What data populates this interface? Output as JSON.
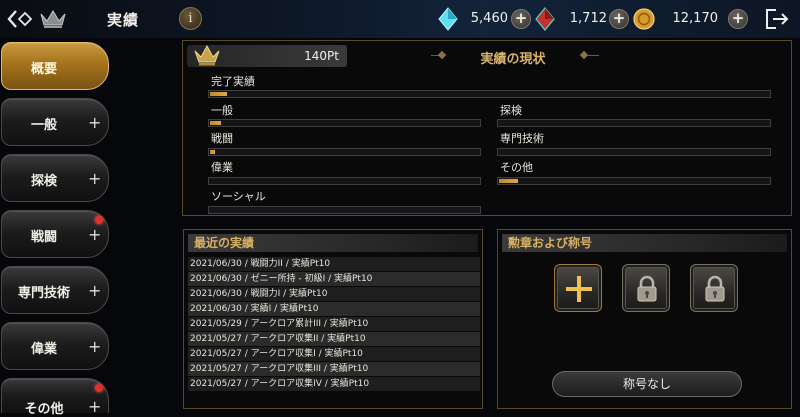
{
  "header": {
    "title": "実績",
    "info_label": "i",
    "currencies": [
      {
        "name": "blue-crystal",
        "value": "5,460",
        "color": "#46d0e6"
      },
      {
        "name": "red-crystal",
        "value": "1,712",
        "color": "#d13a3a"
      },
      {
        "name": "gold-coin",
        "value": "12,170",
        "color": "#d79a2a"
      }
    ],
    "plus_label": "+"
  },
  "sidebar": {
    "items": [
      {
        "label": "概要",
        "active": true,
        "plus": ""
      },
      {
        "label": "一般",
        "active": false,
        "plus": "+"
      },
      {
        "label": "探検",
        "active": false,
        "plus": "+"
      },
      {
        "label": "戦闘",
        "active": false,
        "plus": "+",
        "notify": true
      },
      {
        "label": "専門技術",
        "active": false,
        "plus": "+"
      },
      {
        "label": "偉業",
        "active": false,
        "plus": "+"
      },
      {
        "label": "その他",
        "active": false,
        "plus": "+",
        "notify": true
      }
    ]
  },
  "status": {
    "points": "140Pt",
    "title": "実績の現状",
    "categories": [
      {
        "label": "完了実績",
        "progress": 0.03
      },
      {
        "label": "一般",
        "progress": 0.04
      },
      {
        "label": "探検",
        "progress": 0.0
      },
      {
        "label": "戦闘",
        "progress": 0.02
      },
      {
        "label": "専門技術",
        "progress": 0.0
      },
      {
        "label": "偉業",
        "progress": 0.0
      },
      {
        "label": "その他",
        "progress": 0.07
      },
      {
        "label": "ソーシャル",
        "progress": 0.0
      }
    ]
  },
  "recent": {
    "title": "最近の実績",
    "rows": [
      "2021/06/30 / 戦闘力II / 実績Pt10",
      "2021/06/30 / ゼニー所持 - 初級I / 実績Pt10",
      "2021/06/30 / 戦闘力I / 実績Pt10",
      "2021/06/30 / 実績I / 実績Pt10",
      "2021/05/29 / アークロア累計III / 実績Pt10",
      "2021/05/27 / アークロア収集II / 実績Pt10",
      "2021/05/27 / アークロア収集I / 実績Pt10",
      "2021/05/27 / アークロア収集III / 実績Pt10",
      "2021/05/27 / アークロア収集IV / 実績Pt10"
    ]
  },
  "medals": {
    "title": "勲章および称号",
    "slots": [
      "plus-icon",
      "lock-icon",
      "lock-icon"
    ],
    "title_button": "称号なし"
  }
}
